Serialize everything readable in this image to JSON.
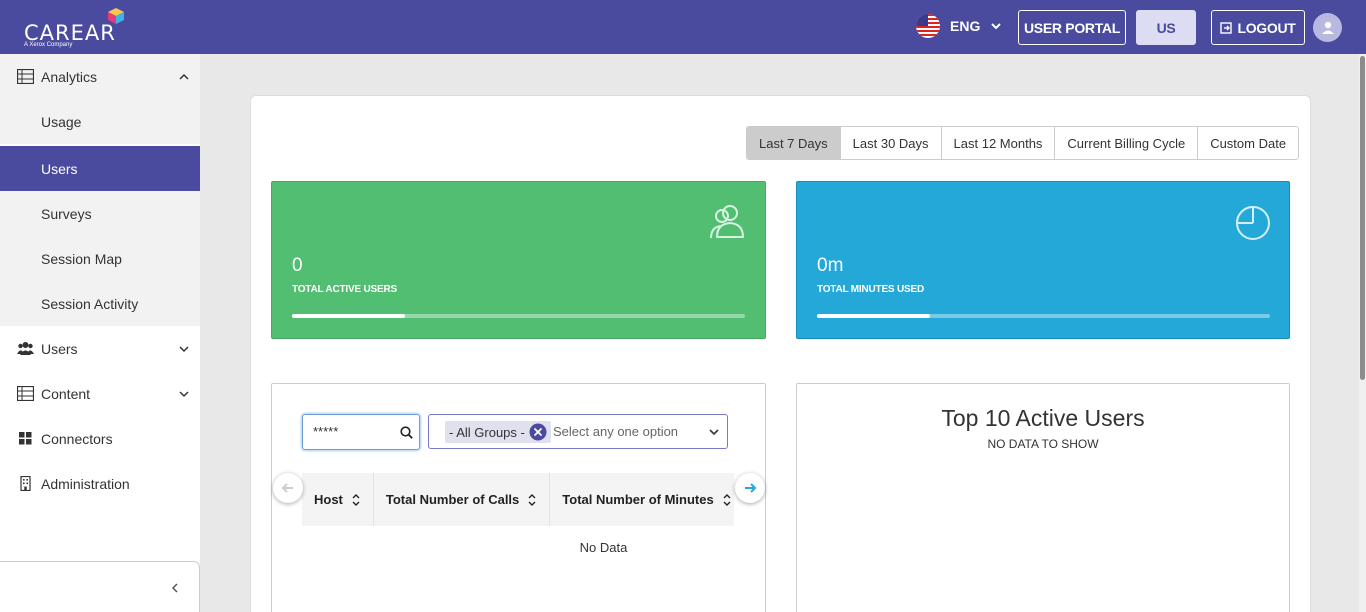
{
  "header": {
    "logo_text": "CAREAR",
    "logo_sub": "A Xerox Company",
    "language": "ENG",
    "user_portal": "USER PORTAL",
    "region": "US",
    "logout": "LOGOUT"
  },
  "sidebar": {
    "analytics": "Analytics",
    "sub_items": [
      "Usage",
      "Users",
      "Surveys",
      "Session Map",
      "Session Activity"
    ],
    "active_sub": "Users",
    "users": "Users",
    "content": "Content",
    "connectors": "Connectors",
    "administration": "Administration"
  },
  "date_range": {
    "options": [
      "Last 7 Days",
      "Last 30 Days",
      "Last 12 Months",
      "Current Billing Cycle",
      "Custom Date"
    ],
    "selected": "Last 7 Days"
  },
  "stats": {
    "active_users": {
      "value": "0",
      "label": "TOTAL ACTIVE USERS",
      "progress": 0.25,
      "color": "#52be72"
    },
    "minutes": {
      "value": "0m",
      "label": "TOTAL MINUTES USED",
      "progress": 0.25,
      "color": "#24a8d8"
    }
  },
  "table_panel": {
    "search_value": "*****",
    "group_chip": "- All Groups -",
    "group_placeholder": "Select any one option",
    "columns": [
      "Host",
      "Total Number of Calls",
      "Total Number of Minutes"
    ],
    "empty_text": "No Data"
  },
  "top_users": {
    "title": "Top 10 Active Users",
    "empty_text": "NO DATA TO SHOW"
  },
  "colors": {
    "brand": "#4a4a9e",
    "active_green": "#52be72",
    "minutes_blue": "#24a8d8"
  }
}
